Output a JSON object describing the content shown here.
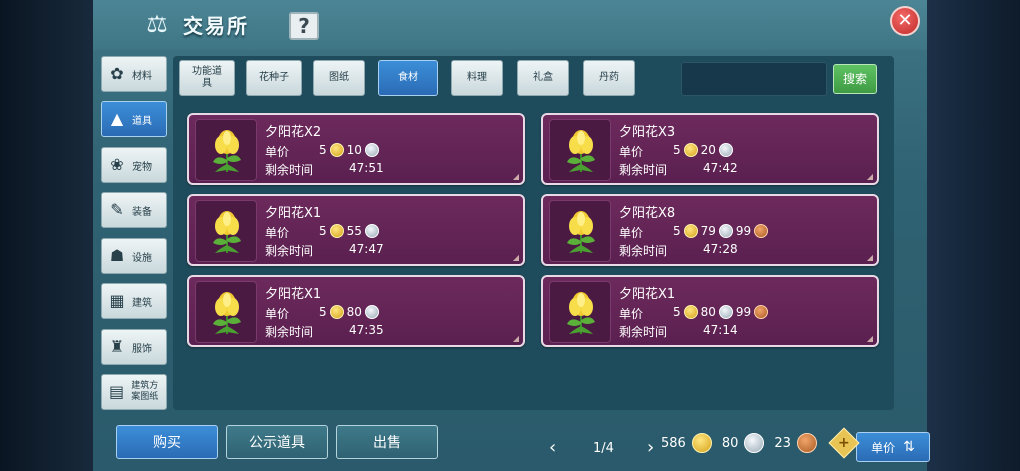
{
  "header": {
    "title": "交易所",
    "help_label": "?",
    "close_label": "✕"
  },
  "sidebar": {
    "items": [
      {
        "label": "材料",
        "icon": "materials-icon",
        "glyph": "✿",
        "active": false
      },
      {
        "label": "道具",
        "icon": "item-icon",
        "glyph": "▲",
        "active": true
      },
      {
        "label": "宠物",
        "icon": "paw-icon",
        "glyph": "❀",
        "active": false
      },
      {
        "label": "装备",
        "icon": "equipment-icon",
        "glyph": "✎",
        "active": false
      },
      {
        "label": "设施",
        "icon": "facility-icon",
        "glyph": "☗",
        "active": false
      },
      {
        "label": "建筑",
        "icon": "building-icon",
        "glyph": "▦",
        "active": false
      },
      {
        "label": "服饰",
        "icon": "clothing-icon",
        "glyph": "♜",
        "active": false
      },
      {
        "label": "建筑方案图纸",
        "icon": "blueprint-icon",
        "glyph": "▤",
        "active": false
      }
    ]
  },
  "tabs": [
    {
      "label": "功能道具",
      "active": false
    },
    {
      "label": "花种子",
      "active": false
    },
    {
      "label": "图纸",
      "active": false
    },
    {
      "label": "食材",
      "active": true
    },
    {
      "label": "料理",
      "active": false
    },
    {
      "label": "礼盒",
      "active": false
    },
    {
      "label": "丹药",
      "active": false
    }
  ],
  "search": {
    "value": "",
    "placeholder": "",
    "button_label": "搜索"
  },
  "listings": [
    {
      "name": "夕阳花X2",
      "price_label": "单价",
      "gold": "5",
      "silver": "10",
      "copper": "",
      "time_label": "剩余时间",
      "time": "47:51"
    },
    {
      "name": "夕阳花X3",
      "price_label": "单价",
      "gold": "5",
      "silver": "20",
      "copper": "",
      "time_label": "剩余时间",
      "time": "47:42"
    },
    {
      "name": "夕阳花X1",
      "price_label": "单价",
      "gold": "5",
      "silver": "55",
      "copper": "",
      "time_label": "剩余时间",
      "time": "47:47"
    },
    {
      "name": "夕阳花X8",
      "price_label": "单价",
      "gold": "5",
      "silver": "79",
      "copper": "99",
      "time_label": "剩余时间",
      "time": "47:28"
    },
    {
      "name": "夕阳花X1",
      "price_label": "单价",
      "gold": "5",
      "silver": "80",
      "copper": "",
      "time_label": "剩余时间",
      "time": "47:35"
    },
    {
      "name": "夕阳花X1",
      "price_label": "单价",
      "gold": "5",
      "silver": "80",
      "copper": "99",
      "time_label": "剩余时间",
      "time": "47:14"
    }
  ],
  "pagination": {
    "text": "1/4",
    "prev": "‹",
    "next": "›"
  },
  "sort": {
    "label": "单价"
  },
  "bottom": {
    "buy_label": "购买",
    "public_label": "公示道具",
    "sell_label": "出售"
  },
  "wallet": {
    "gold": "586",
    "silver": "80",
    "copper": "23",
    "add_label": "+"
  }
}
